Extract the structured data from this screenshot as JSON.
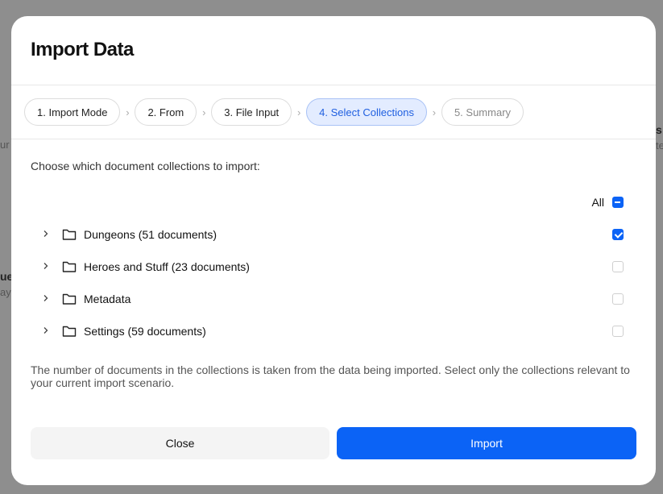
{
  "background": {
    "texts": [
      {
        "id": "bg-left-1",
        "text": "ur"
      },
      {
        "id": "bg-left-2",
        "text": "ue"
      },
      {
        "id": "bg-left-3",
        "text": "ay"
      },
      {
        "id": "bg-right-1",
        "text": "s"
      },
      {
        "id": "bg-right-2",
        "text": "te"
      }
    ]
  },
  "modal": {
    "title": "Import Data",
    "steps": [
      {
        "label": "1. Import Mode",
        "state": "done"
      },
      {
        "label": "2. From",
        "state": "done"
      },
      {
        "label": "3. File Input",
        "state": "done"
      },
      {
        "label": "4. Select Collections",
        "state": "active"
      },
      {
        "label": "5. Summary",
        "state": "upcoming"
      }
    ],
    "instruction": "Choose which document collections to import:",
    "all_label": "All",
    "all_state": "indeterminate",
    "collections": [
      {
        "label": "Dungeons (51 documents)",
        "checked": true
      },
      {
        "label": "Heroes and Stuff (23 documents)",
        "checked": false
      },
      {
        "label": "Metadata",
        "checked": false
      },
      {
        "label": "Settings (59 documents)",
        "checked": false
      }
    ],
    "footnote": "The number of documents in the collections is taken from the data being imported. Select only the collections relevant to your current import scenario.",
    "close_label": "Close",
    "import_label": "Import"
  },
  "colors": {
    "accent": "#0b63f6",
    "active_step_bg": "#e3ecff",
    "overlay": "#8e8e8e"
  },
  "icons": {
    "step_separator": "chevron-right-icon",
    "collection_expand": "chevron-right-icon",
    "collection_type": "folder-icon"
  }
}
